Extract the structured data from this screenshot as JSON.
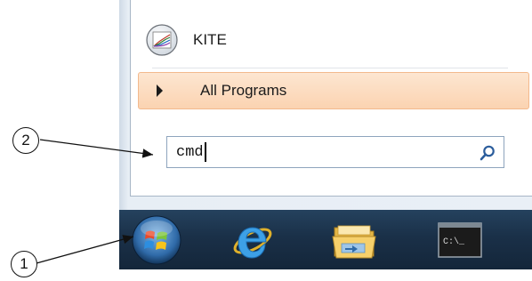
{
  "start_menu": {
    "pinned_program": {
      "label": "KITE",
      "icon": "kite-program-icon"
    },
    "all_programs": {
      "label": "All Programs",
      "icon": "arrow-right-icon"
    },
    "search": {
      "value": "cmd",
      "icon": "search-icon"
    }
  },
  "taskbar": {
    "items": [
      {
        "name": "start-button",
        "icon": "windows-orb-icon"
      },
      {
        "name": "internet-explorer",
        "icon": "internet-explorer-icon"
      },
      {
        "name": "windows-explorer",
        "icon": "folder-icon"
      },
      {
        "name": "command-prompt",
        "icon": "cmd-icon",
        "text": "C:\\_"
      }
    ]
  },
  "callouts": [
    {
      "number": "1"
    },
    {
      "number": "2"
    }
  ],
  "colors": {
    "taskbar": "#1a3048",
    "highlight": "#fbd3b1",
    "highlight_border": "#f3b98d",
    "search_border": "#8ea4bd"
  }
}
